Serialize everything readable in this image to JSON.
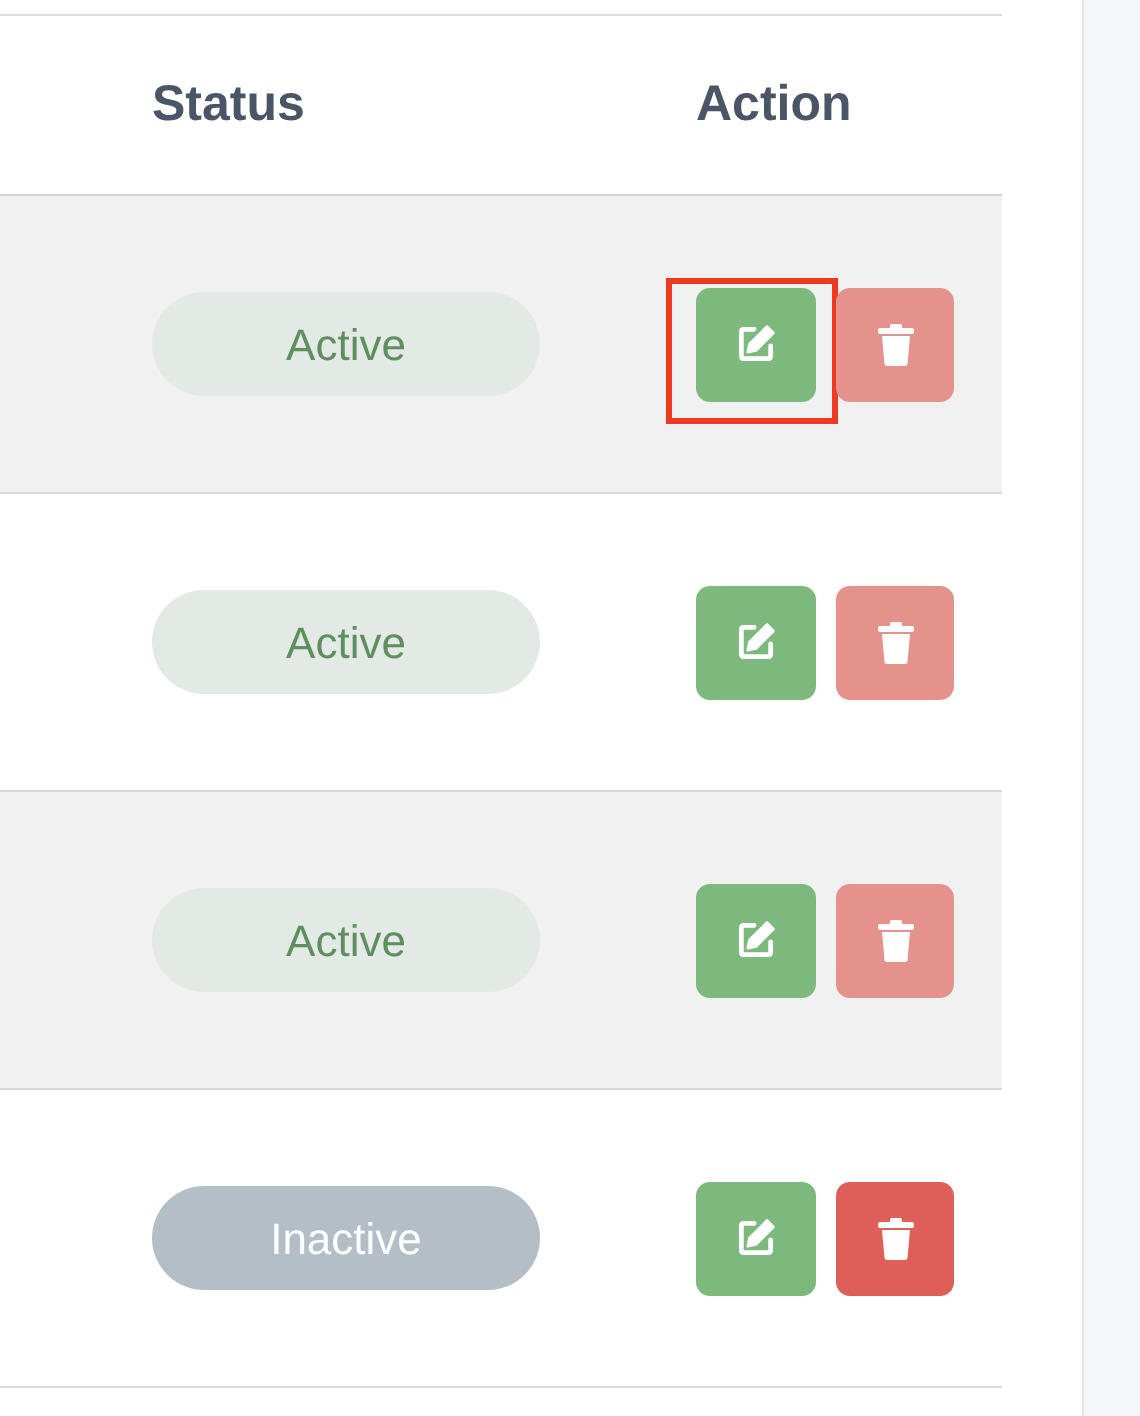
{
  "table": {
    "columns": [
      "Status",
      "Action"
    ],
    "rows": [
      {
        "status": "Active",
        "active": true,
        "edit_focused": true,
        "delete_disabled": true
      },
      {
        "status": "Active",
        "active": true,
        "edit_focused": false,
        "delete_disabled": true
      },
      {
        "status": "Active",
        "active": true,
        "edit_focused": false,
        "delete_disabled": true
      },
      {
        "status": "Inactive",
        "active": false,
        "edit_focused": false,
        "delete_disabled": false
      }
    ]
  }
}
